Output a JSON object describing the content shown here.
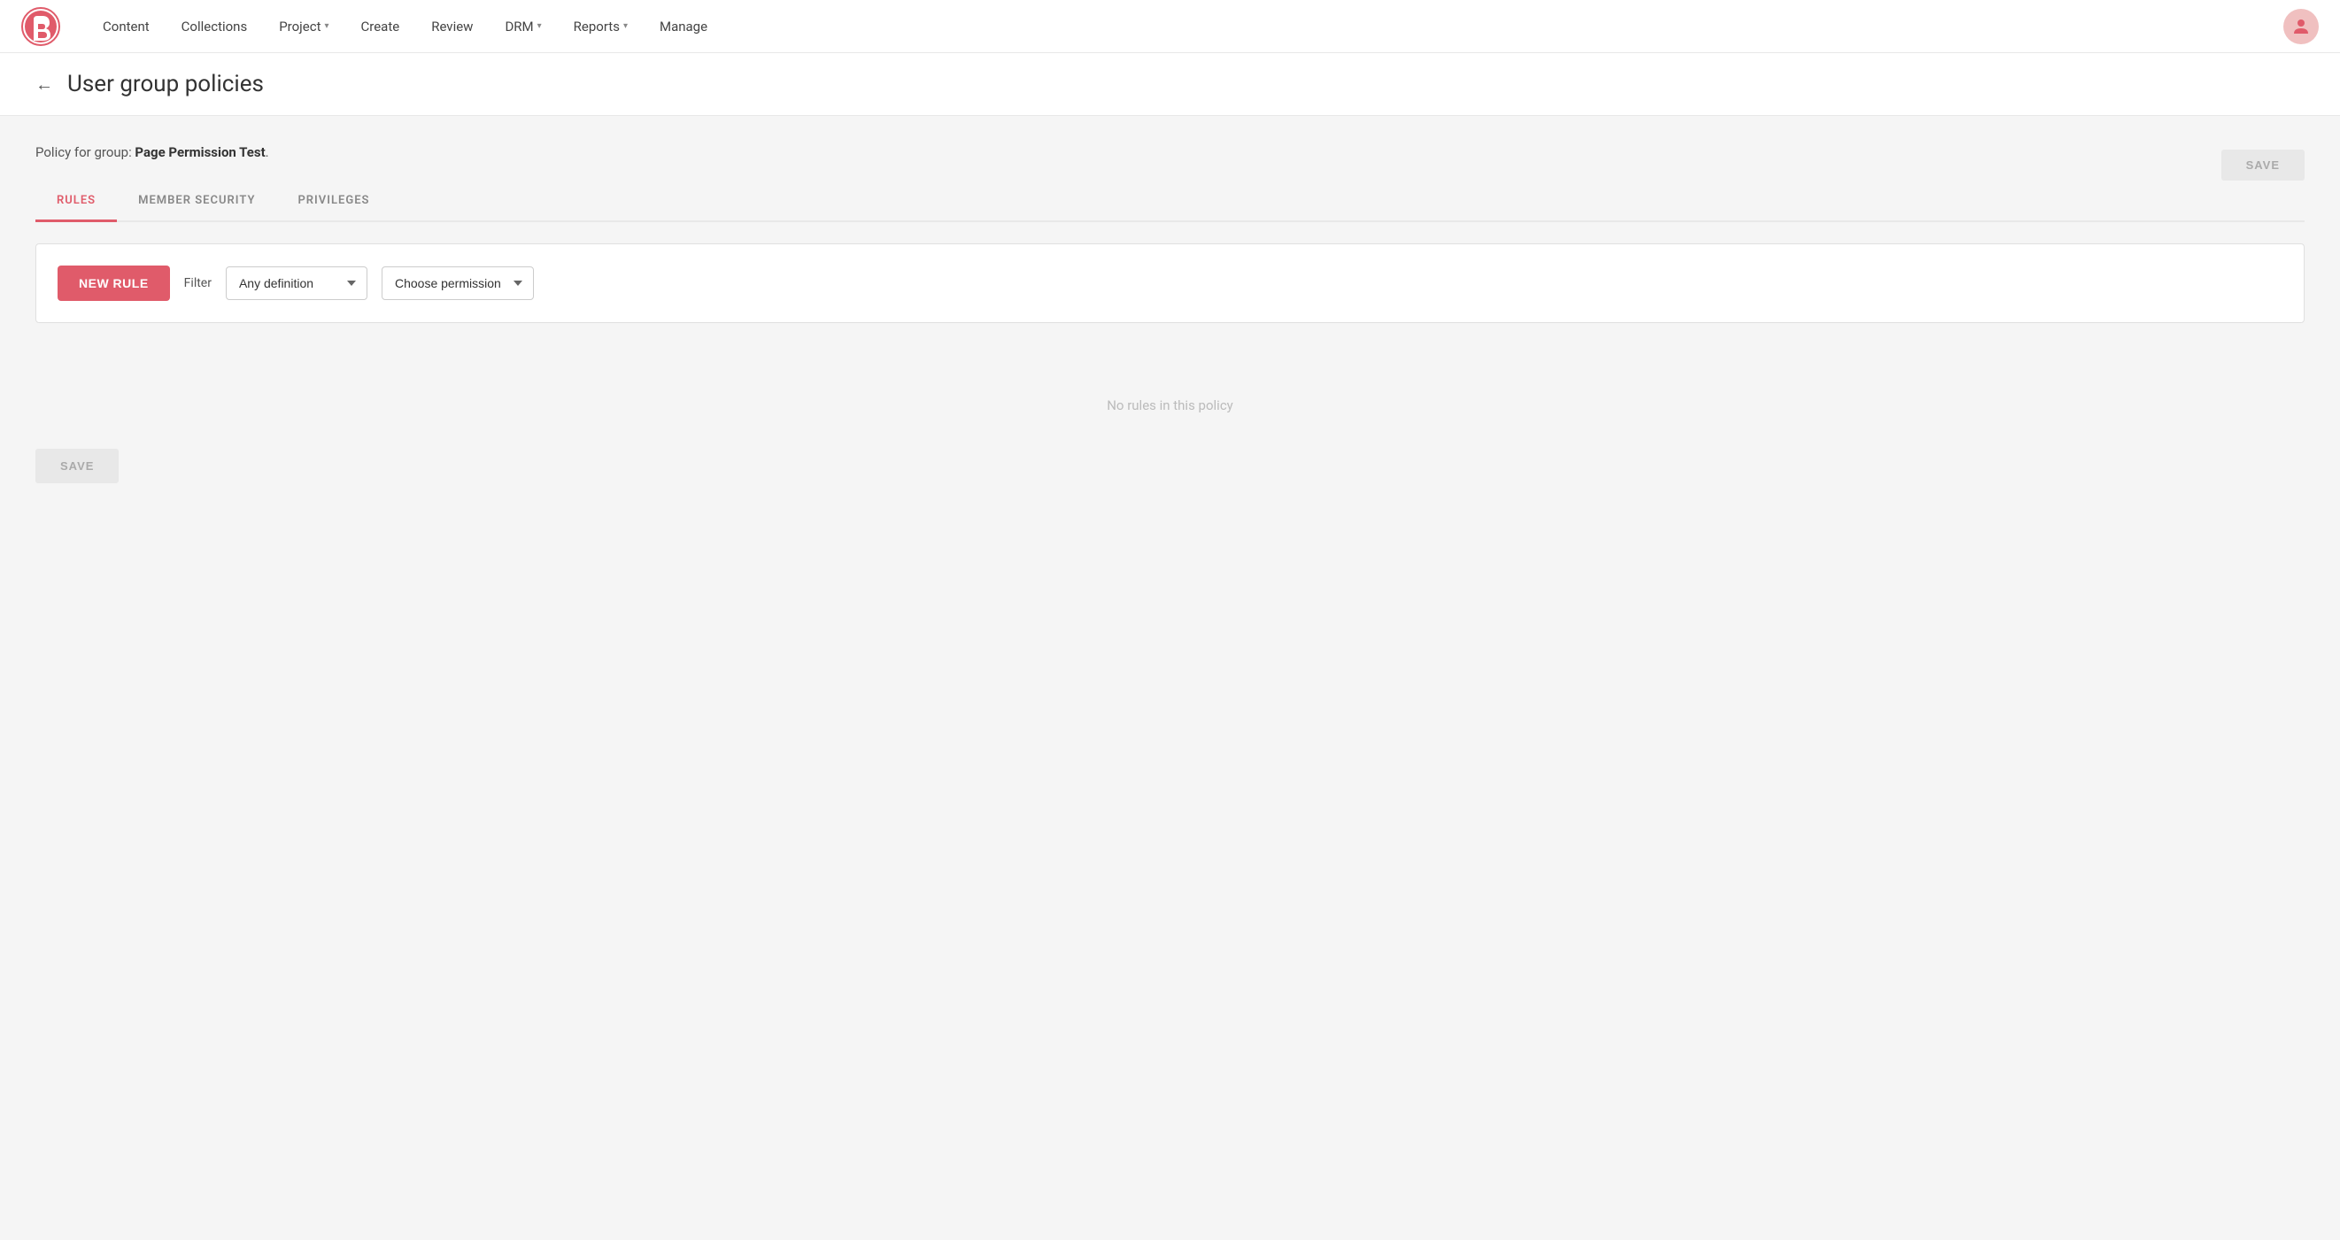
{
  "brand": {
    "logo_alt": "Bynder logo"
  },
  "nav": {
    "items": [
      {
        "label": "Content",
        "has_dropdown": false
      },
      {
        "label": "Collections",
        "has_dropdown": false
      },
      {
        "label": "Project",
        "has_dropdown": true
      },
      {
        "label": "Create",
        "has_dropdown": false
      },
      {
        "label": "Review",
        "has_dropdown": false
      },
      {
        "label": "DRM",
        "has_dropdown": true
      },
      {
        "label": "Reports",
        "has_dropdown": true
      },
      {
        "label": "Manage",
        "has_dropdown": false
      }
    ]
  },
  "page": {
    "title": "User group policies",
    "back_label": "←"
  },
  "policy": {
    "prefix": "Policy for group: ",
    "group_name": "Page Permission Test",
    "suffix": "."
  },
  "save_top_label": "SAVE",
  "tabs": [
    {
      "label": "RULES",
      "active": true
    },
    {
      "label": "MEMBER SECURITY",
      "active": false
    },
    {
      "label": "PRIVILEGES",
      "active": false
    }
  ],
  "toolbar": {
    "new_rule_label": "NEW RULE",
    "filter_label": "Filter",
    "definition_dropdown_value": "Any definition",
    "permission_dropdown_placeholder": "Choose permission",
    "definition_options": [
      "Any definition"
    ],
    "permission_options": [
      "Choose permission"
    ]
  },
  "empty_state": {
    "message": "No rules in this policy"
  },
  "save_bottom_label": "SAVE"
}
